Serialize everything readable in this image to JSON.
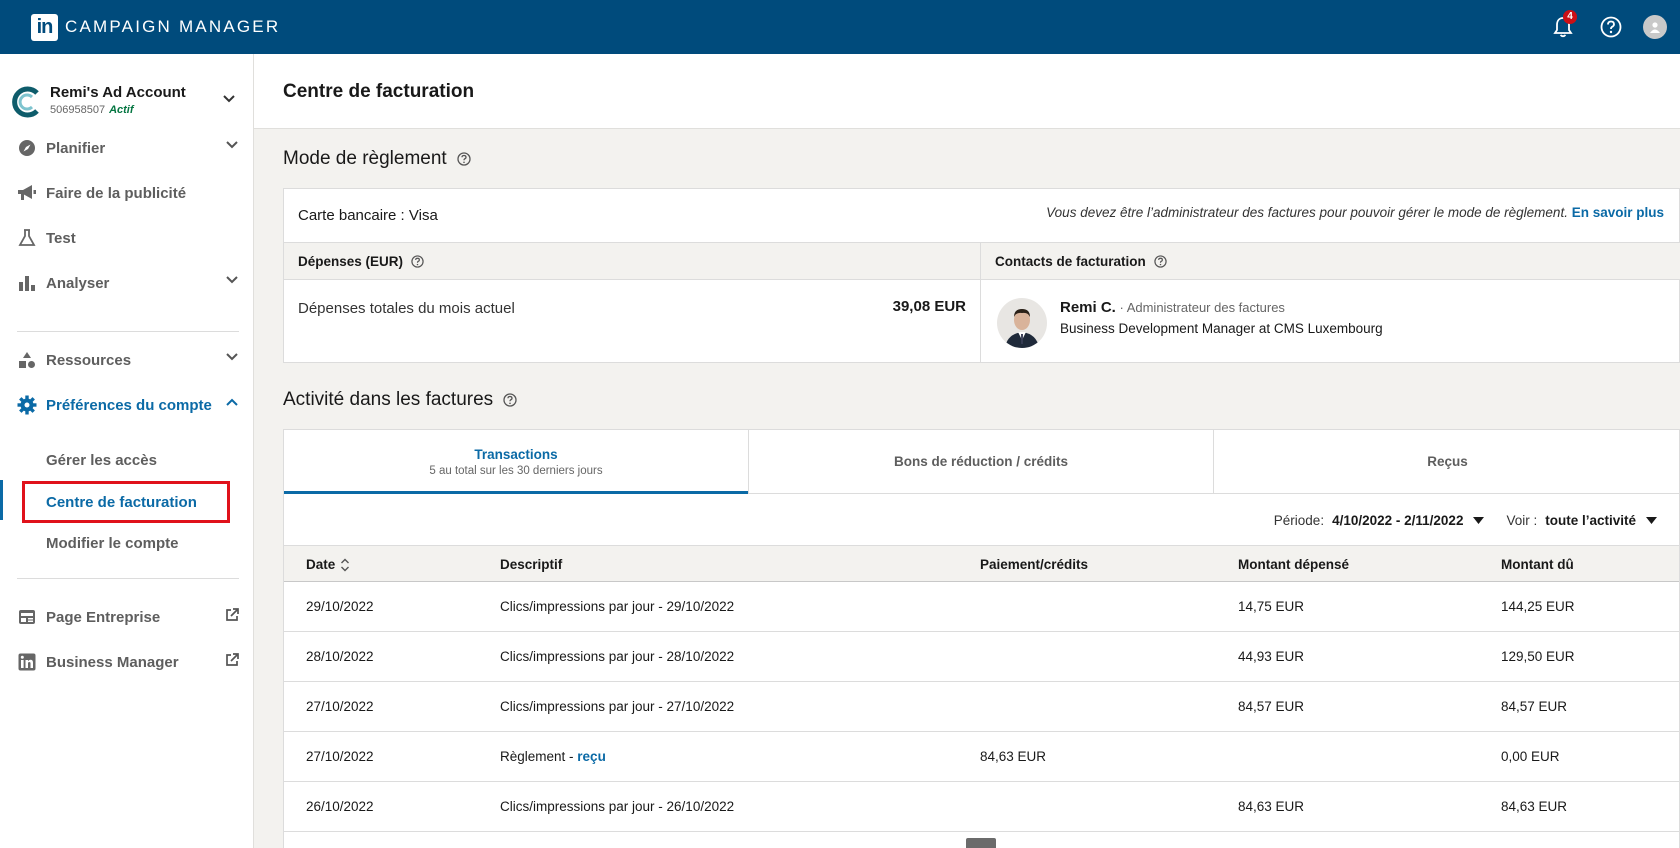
{
  "app": {
    "brand": "CAMPAIGN MANAGER",
    "logo_text": "in",
    "notifications_count": "4"
  },
  "account": {
    "name": "Remi's Ad Account",
    "id": "506958507",
    "status": "Actif"
  },
  "sidebar": {
    "items": [
      {
        "label": "Planifier",
        "icon": "compass-icon"
      },
      {
        "label": "Faire de la publicité",
        "icon": "megaphone-icon"
      },
      {
        "label": "Test",
        "icon": "flask-icon"
      },
      {
        "label": "Analyser",
        "icon": "bar-chart-icon"
      },
      {
        "label": "Ressources",
        "icon": "shapes-icon"
      },
      {
        "label": "Préférences du compte",
        "icon": "gear-icon"
      },
      {
        "label": "Page Entreprise",
        "icon": "company-page-icon"
      },
      {
        "label": "Business Manager",
        "icon": "linkedin-icon"
      }
    ],
    "subitems": [
      "Gérer les accès",
      "Centre de facturation",
      "Modifier le compte"
    ]
  },
  "page": {
    "title": "Centre de facturation"
  },
  "payment": {
    "section_title": "Mode de règlement",
    "card_label": "Carte bancaire : Visa",
    "admin_note": "Vous devez être l’administrateur des factures pour pouvoir gérer le mode de règlement.",
    "learn_more": "En savoir plus",
    "spend_header": "Dépenses (EUR)",
    "spend_label": "Dépenses totales du mois actuel",
    "spend_value": "39,08 EUR",
    "contacts_header": "Contacts de facturation",
    "contact_name": "Remi C.",
    "contact_role": " · Administrateur des factures",
    "contact_title": "Business Development Manager at CMS Luxembourg"
  },
  "invoices": {
    "section_title": "Activité dans les factures",
    "tabs": [
      {
        "label": "Transactions",
        "sub": "5 au total sur les 30 derniers jours"
      },
      {
        "label": "Bons de réduction / crédits"
      },
      {
        "label": "Reçus"
      }
    ],
    "period_label": "Période:",
    "period_value": "4/10/2022 - 2/11/2022",
    "view_label": "Voir :",
    "view_value": "toute l’activité",
    "columns": [
      "Date",
      "Descriptif",
      "Paiement/crédits",
      "Montant dépensé",
      "Montant dû"
    ],
    "rows": [
      {
        "date": "29/10/2022",
        "desc": "Clics/impressions par jour - 29/10/2022",
        "pay": "",
        "spent": "14,75 EUR",
        "due": "144,25 EUR"
      },
      {
        "date": "28/10/2022",
        "desc": "Clics/impressions par jour - 28/10/2022",
        "pay": "",
        "spent": "44,93 EUR",
        "due": "129,50 EUR"
      },
      {
        "date": "27/10/2022",
        "desc": "Clics/impressions par jour - 27/10/2022",
        "pay": "",
        "spent": "84,57 EUR",
        "due": "84,57 EUR"
      },
      {
        "date": "27/10/2022",
        "desc": "Règlement - ",
        "desc_link": "reçu",
        "pay": "84,63 EUR",
        "spent": "",
        "due": "0,00 EUR"
      },
      {
        "date": "26/10/2022",
        "desc": "Clics/impressions par jour - 26/10/2022",
        "pay": "",
        "spent": "84,63 EUR",
        "due": "84,63 EUR"
      }
    ]
  },
  "colors": {
    "topbar": "#004b7c",
    "accent": "#0b6aa6",
    "active_status": "#057642",
    "highlight_box": "#e0121b",
    "badge": "#cc1016"
  }
}
